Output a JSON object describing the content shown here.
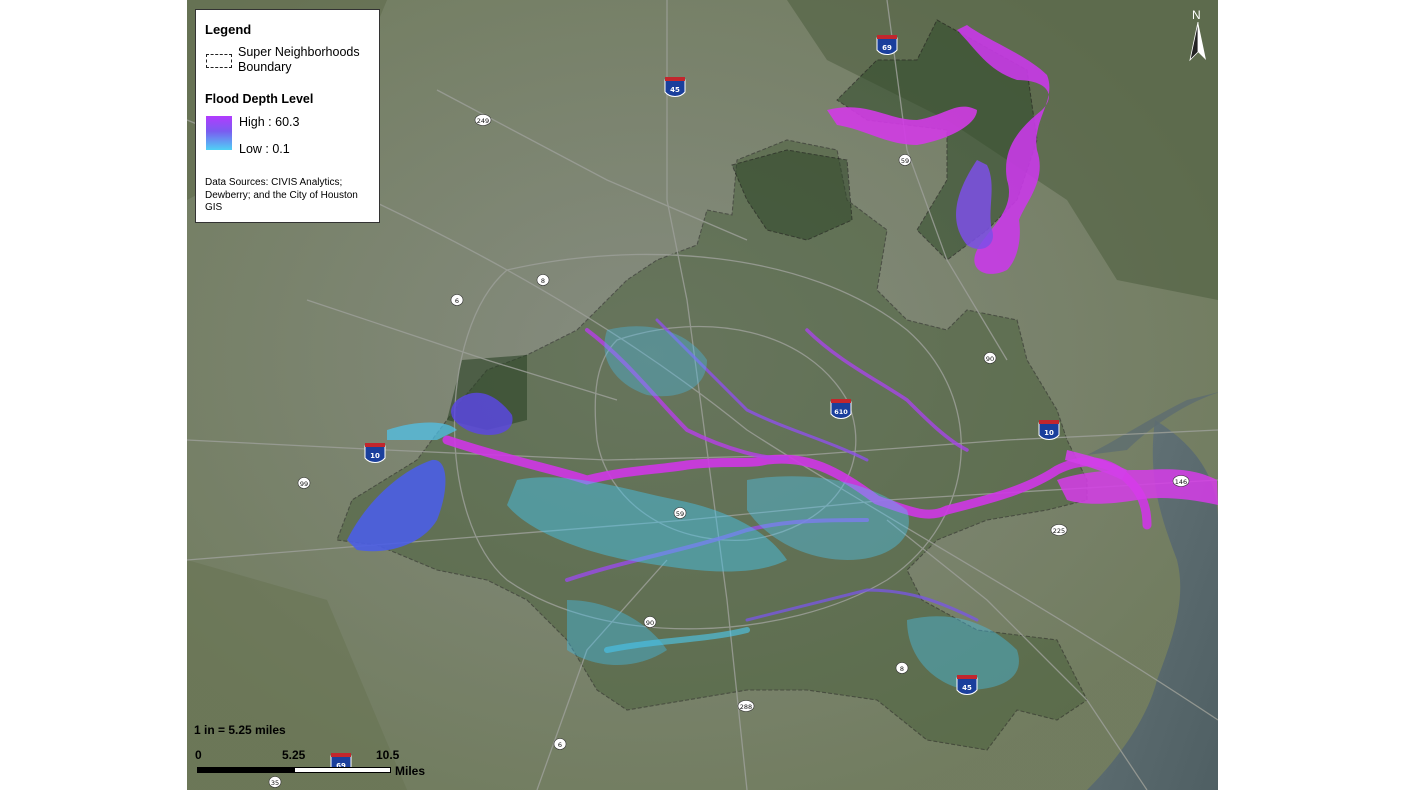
{
  "legend": {
    "title": "Legend",
    "boundary_label": "Super Neighborhoods Boundary",
    "flood_title": "Flood Depth Level",
    "high_label": "High : 60.3",
    "low_label": "Low : 0.1",
    "sources": "Data Sources: CIVIS Analytics; Dewberry; and the City of Houston GIS"
  },
  "scale": {
    "ratio": "1 in = 5.25 miles",
    "tick_0": "0",
    "tick_1": "5.25",
    "tick_2": "10.5",
    "units": "Miles"
  },
  "north_arrow": {
    "label": "N",
    "icon": "north-arrow-icon"
  },
  "highway_shields": {
    "i69_north": "69",
    "i45_north": "45",
    "i610": "610",
    "i10_west": "10",
    "i10_east": "10",
    "i45_south": "45",
    "i69_south": "69"
  },
  "route_markers": {
    "r249": "249",
    "r8_north": "8",
    "r6_north": "6",
    "r99": "99",
    "r59": "59",
    "r90_center": "90",
    "r90_east": "90",
    "r225": "225",
    "r146": "146",
    "r8_south": "8",
    "r288": "288",
    "r6_south": "6",
    "r35": "35",
    "r59_n": "59"
  },
  "colors": {
    "flood_high": "#d432e8",
    "flood_mid": "#6a57f0",
    "flood_low": "#4fd1f5",
    "satellite_base": "#6f7a5e",
    "bay_water": "#5d6b6f"
  }
}
